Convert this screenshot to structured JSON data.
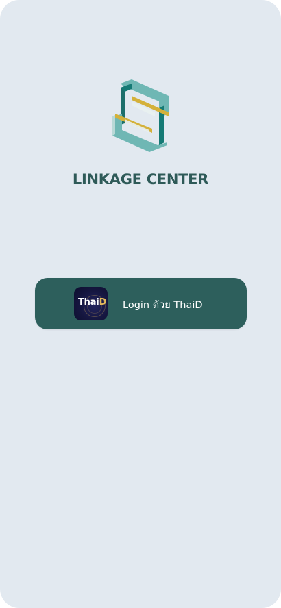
{
  "app": {
    "title": "LINKAGE CENTER",
    "logo_icon": "linkage-center-logo"
  },
  "login": {
    "label": "Login ด้วย ThaiD",
    "icon": "thaid-icon",
    "icon_text_main": "Thai",
    "icon_text_accent": "D",
    "icon_text_dot": "i"
  },
  "colors": {
    "background": "#e2e9f0",
    "primary": "#2d5f5c",
    "title": "#2e5a58",
    "teal_light": "#6fb7b4",
    "teal_dark": "#1d7a76",
    "gold": "#d4b13a"
  }
}
